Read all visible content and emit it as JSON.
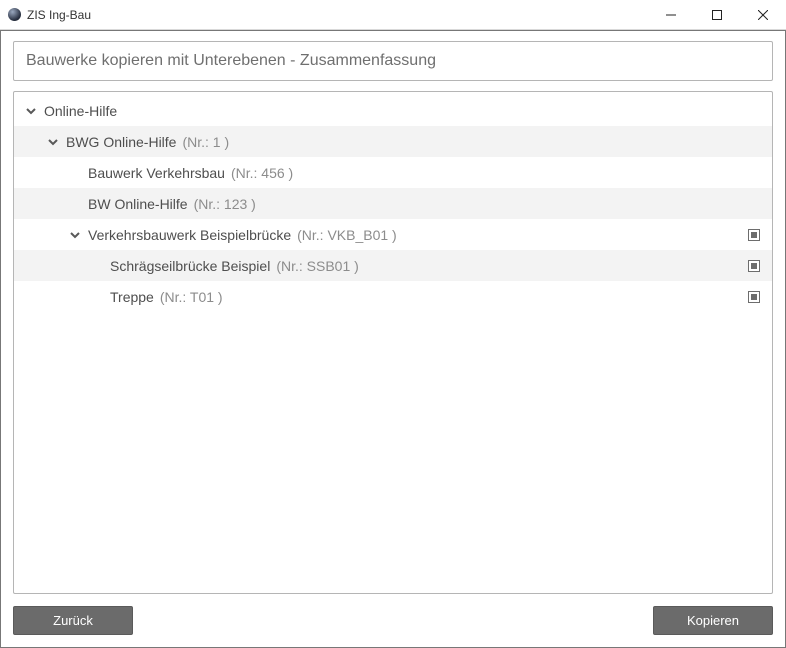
{
  "window": {
    "title": "ZIS Ing-Bau"
  },
  "header": {
    "title": "Bauwerke kopieren mit Unterebenen - Zusammenfassung"
  },
  "nr_prefix": "Nr.: ",
  "tree": [
    {
      "indent": 0,
      "expand": true,
      "label": "Online-Hilfe",
      "nr": null,
      "cb": false,
      "alt": false
    },
    {
      "indent": 1,
      "expand": true,
      "label": "BWG Online-Hilfe",
      "nr": "1 ",
      "cb": false,
      "alt": true
    },
    {
      "indent": 2,
      "expand": false,
      "label": "Bauwerk Verkehrsbau",
      "nr": "456 ",
      "cb": false,
      "alt": false
    },
    {
      "indent": 2,
      "expand": false,
      "label": "BW Online-Hilfe",
      "nr": "123 ",
      "cb": false,
      "alt": true
    },
    {
      "indent": 2,
      "expand": true,
      "label": "Verkehrsbauwerk Beispielbrücke",
      "nr": "VKB_B01 ",
      "cb": true,
      "alt": false
    },
    {
      "indent": 3,
      "expand": false,
      "label": "Schrägseilbrücke Beispiel",
      "nr": "SSB01 ",
      "cb": true,
      "alt": true
    },
    {
      "indent": 3,
      "expand": false,
      "label": "Treppe",
      "nr": "T01 ",
      "cb": true,
      "alt": false
    }
  ],
  "footer": {
    "back": "Zurück",
    "copy": "Kopieren"
  }
}
